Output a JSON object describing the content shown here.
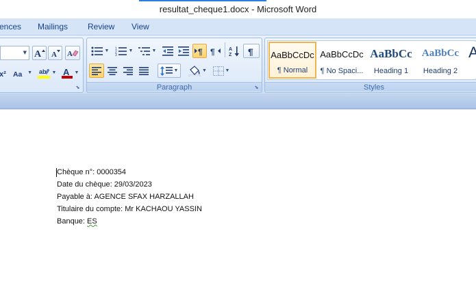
{
  "window": {
    "title": "resultat_cheque1.docx - Microsoft Word"
  },
  "tabs": [
    {
      "label": "ences"
    },
    {
      "label": "Mailings"
    },
    {
      "label": "Review"
    },
    {
      "label": "View"
    }
  ],
  "ribbon": {
    "paragraph_group": {
      "label": "Paragraph"
    },
    "styles_group": {
      "label": "Styles",
      "styles": [
        {
          "sample": "AaBbCcDc",
          "name": "¶ Normal",
          "selected": true
        },
        {
          "sample": "AaBbCcDc",
          "name": "¶ No Spaci...",
          "selected": false
        },
        {
          "sample": "AaBbCc",
          "name": "Heading 1",
          "selected": false
        },
        {
          "sample": "AaBbCc",
          "name": "Heading 2",
          "selected": false
        },
        {
          "sample": "A",
          "name": "",
          "selected": false
        }
      ]
    },
    "colors": {
      "highlight": "#ffff00",
      "font_color": "#c00000",
      "accent": "#15428b"
    }
  },
  "document": {
    "lines": [
      {
        "label": "Chèque n°: ",
        "value": "0000354"
      },
      {
        "label": "Date du chèque: ",
        "value": "29/03/2023"
      },
      {
        "label": "Payable à: ",
        "value": "AGENCE SFAX HARZALLAH"
      },
      {
        "label": "Titulaire du compte: ",
        "value": "Mr KACHAOU YASSIN"
      },
      {
        "label": "Banque: ",
        "value": "ES"
      }
    ]
  }
}
